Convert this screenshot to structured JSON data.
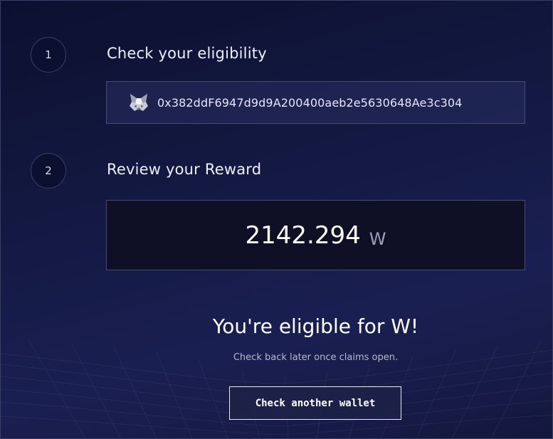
{
  "steps": [
    {
      "number": "1",
      "title": "Check your eligibility"
    },
    {
      "number": "2",
      "title": "Review your Reward"
    }
  ],
  "wallet": {
    "icon": "metamask-fox-icon",
    "address": "0x382ddF6947d9d9A200400aeb2e5630648Ae3c304"
  },
  "reward": {
    "amount": "2142.294",
    "unit": "W"
  },
  "result": {
    "headline": "You're eligible for W!",
    "subtext": "Check back later once claims open."
  },
  "cta": {
    "label": "Check another wallet"
  },
  "colors": {
    "background": "#141a44",
    "border": "#474c74",
    "reward_box": "#0f1026",
    "text": "#ffffff",
    "muted_text": "#b6b9cf"
  }
}
